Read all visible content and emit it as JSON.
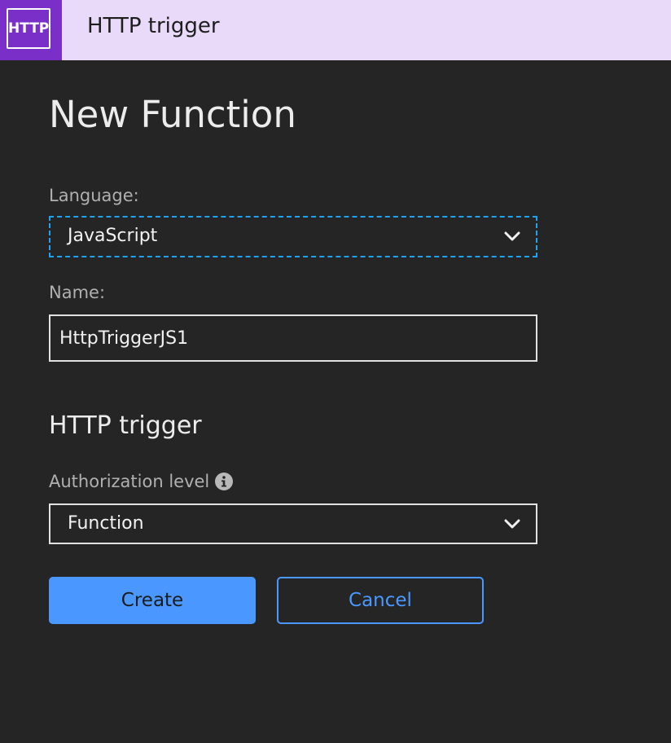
{
  "header": {
    "icon_text": "HTTP",
    "title": "HTTP trigger",
    "colors": {
      "bar": "#e8daf8",
      "icon_bg": "#7a2fc8"
    }
  },
  "page": {
    "title": "New Function"
  },
  "form": {
    "language": {
      "label": "Language:",
      "value": "JavaScript",
      "icon": "chevron-down-icon"
    },
    "name": {
      "label": "Name:",
      "value": "HttpTriggerJS1"
    },
    "trigger_section": {
      "title": "HTTP trigger",
      "authorization": {
        "label": "Authorization level",
        "info_icon": "info-icon",
        "value": "Function",
        "icon": "chevron-down-icon"
      }
    }
  },
  "actions": {
    "create_label": "Create",
    "cancel_label": "Cancel",
    "accent_color": "#4a98ff",
    "focus_color": "#1ea3f0"
  }
}
